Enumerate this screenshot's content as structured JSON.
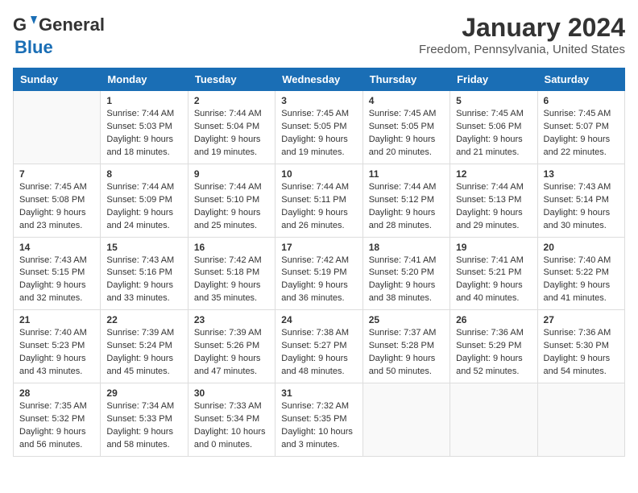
{
  "logo": {
    "general": "General",
    "blue": "Blue"
  },
  "title": "January 2024",
  "location": "Freedom, Pennsylvania, United States",
  "weekdays": [
    "Sunday",
    "Monday",
    "Tuesday",
    "Wednesday",
    "Thursday",
    "Friday",
    "Saturday"
  ],
  "weeks": [
    [
      {
        "day": "",
        "info": ""
      },
      {
        "day": "1",
        "info": "Sunrise: 7:44 AM\nSunset: 5:03 PM\nDaylight: 9 hours\nand 18 minutes."
      },
      {
        "day": "2",
        "info": "Sunrise: 7:44 AM\nSunset: 5:04 PM\nDaylight: 9 hours\nand 19 minutes."
      },
      {
        "day": "3",
        "info": "Sunrise: 7:45 AM\nSunset: 5:05 PM\nDaylight: 9 hours\nand 19 minutes."
      },
      {
        "day": "4",
        "info": "Sunrise: 7:45 AM\nSunset: 5:05 PM\nDaylight: 9 hours\nand 20 minutes."
      },
      {
        "day": "5",
        "info": "Sunrise: 7:45 AM\nSunset: 5:06 PM\nDaylight: 9 hours\nand 21 minutes."
      },
      {
        "day": "6",
        "info": "Sunrise: 7:45 AM\nSunset: 5:07 PM\nDaylight: 9 hours\nand 22 minutes."
      }
    ],
    [
      {
        "day": "7",
        "info": "Sunrise: 7:45 AM\nSunset: 5:08 PM\nDaylight: 9 hours\nand 23 minutes."
      },
      {
        "day": "8",
        "info": "Sunrise: 7:44 AM\nSunset: 5:09 PM\nDaylight: 9 hours\nand 24 minutes."
      },
      {
        "day": "9",
        "info": "Sunrise: 7:44 AM\nSunset: 5:10 PM\nDaylight: 9 hours\nand 25 minutes."
      },
      {
        "day": "10",
        "info": "Sunrise: 7:44 AM\nSunset: 5:11 PM\nDaylight: 9 hours\nand 26 minutes."
      },
      {
        "day": "11",
        "info": "Sunrise: 7:44 AM\nSunset: 5:12 PM\nDaylight: 9 hours\nand 28 minutes."
      },
      {
        "day": "12",
        "info": "Sunrise: 7:44 AM\nSunset: 5:13 PM\nDaylight: 9 hours\nand 29 minutes."
      },
      {
        "day": "13",
        "info": "Sunrise: 7:43 AM\nSunset: 5:14 PM\nDaylight: 9 hours\nand 30 minutes."
      }
    ],
    [
      {
        "day": "14",
        "info": "Sunrise: 7:43 AM\nSunset: 5:15 PM\nDaylight: 9 hours\nand 32 minutes."
      },
      {
        "day": "15",
        "info": "Sunrise: 7:43 AM\nSunset: 5:16 PM\nDaylight: 9 hours\nand 33 minutes."
      },
      {
        "day": "16",
        "info": "Sunrise: 7:42 AM\nSunset: 5:18 PM\nDaylight: 9 hours\nand 35 minutes."
      },
      {
        "day": "17",
        "info": "Sunrise: 7:42 AM\nSunset: 5:19 PM\nDaylight: 9 hours\nand 36 minutes."
      },
      {
        "day": "18",
        "info": "Sunrise: 7:41 AM\nSunset: 5:20 PM\nDaylight: 9 hours\nand 38 minutes."
      },
      {
        "day": "19",
        "info": "Sunrise: 7:41 AM\nSunset: 5:21 PM\nDaylight: 9 hours\nand 40 minutes."
      },
      {
        "day": "20",
        "info": "Sunrise: 7:40 AM\nSunset: 5:22 PM\nDaylight: 9 hours\nand 41 minutes."
      }
    ],
    [
      {
        "day": "21",
        "info": "Sunrise: 7:40 AM\nSunset: 5:23 PM\nDaylight: 9 hours\nand 43 minutes."
      },
      {
        "day": "22",
        "info": "Sunrise: 7:39 AM\nSunset: 5:24 PM\nDaylight: 9 hours\nand 45 minutes."
      },
      {
        "day": "23",
        "info": "Sunrise: 7:39 AM\nSunset: 5:26 PM\nDaylight: 9 hours\nand 47 minutes."
      },
      {
        "day": "24",
        "info": "Sunrise: 7:38 AM\nSunset: 5:27 PM\nDaylight: 9 hours\nand 48 minutes."
      },
      {
        "day": "25",
        "info": "Sunrise: 7:37 AM\nSunset: 5:28 PM\nDaylight: 9 hours\nand 50 minutes."
      },
      {
        "day": "26",
        "info": "Sunrise: 7:36 AM\nSunset: 5:29 PM\nDaylight: 9 hours\nand 52 minutes."
      },
      {
        "day": "27",
        "info": "Sunrise: 7:36 AM\nSunset: 5:30 PM\nDaylight: 9 hours\nand 54 minutes."
      }
    ],
    [
      {
        "day": "28",
        "info": "Sunrise: 7:35 AM\nSunset: 5:32 PM\nDaylight: 9 hours\nand 56 minutes."
      },
      {
        "day": "29",
        "info": "Sunrise: 7:34 AM\nSunset: 5:33 PM\nDaylight: 9 hours\nand 58 minutes."
      },
      {
        "day": "30",
        "info": "Sunrise: 7:33 AM\nSunset: 5:34 PM\nDaylight: 10 hours\nand 0 minutes."
      },
      {
        "day": "31",
        "info": "Sunrise: 7:32 AM\nSunset: 5:35 PM\nDaylight: 10 hours\nand 3 minutes."
      },
      {
        "day": "",
        "info": ""
      },
      {
        "day": "",
        "info": ""
      },
      {
        "day": "",
        "info": ""
      }
    ]
  ]
}
